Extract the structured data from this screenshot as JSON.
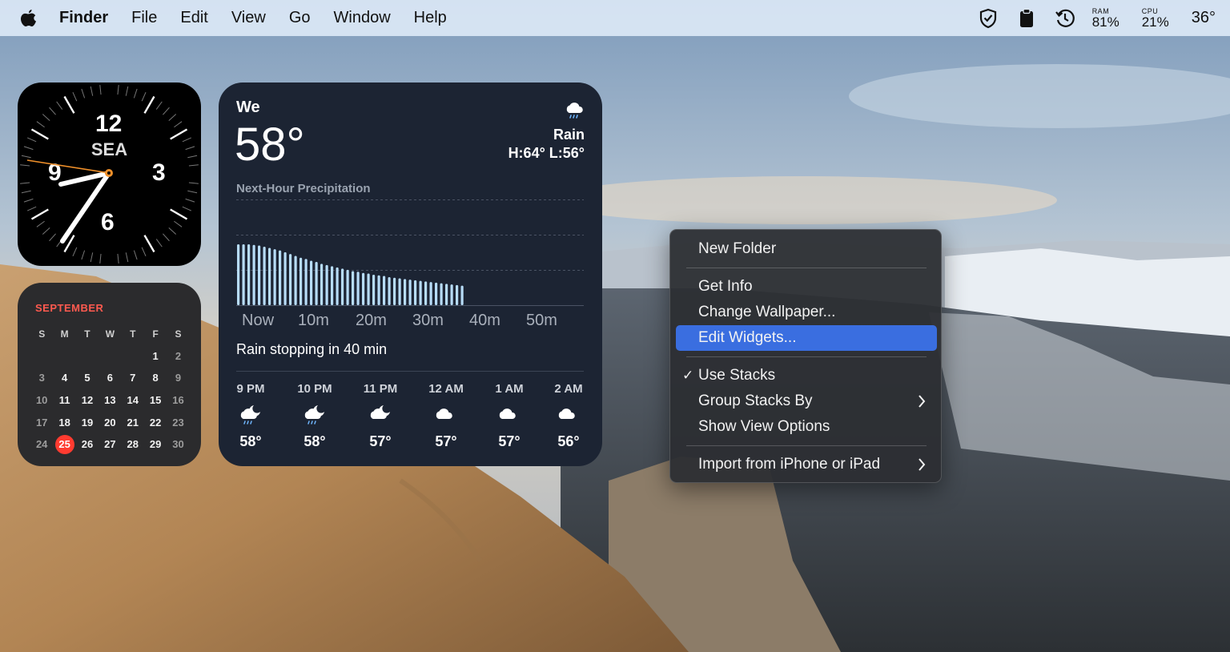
{
  "menubar": {
    "app_name": "Finder",
    "menus": [
      "File",
      "Edit",
      "View",
      "Go",
      "Window",
      "Help"
    ],
    "ram": {
      "label": "RAM",
      "value": "81%"
    },
    "cpu": {
      "label": "CPU",
      "value": "21%"
    },
    "temperature": "36°"
  },
  "clock": {
    "numbers": [
      "12",
      "3",
      "6",
      "9"
    ],
    "city": "SEA"
  },
  "calendar": {
    "month": "SEPTEMBER",
    "weekdays": [
      "S",
      "M",
      "T",
      "W",
      "T",
      "F",
      "S"
    ],
    "weeks": [
      [
        "",
        "",
        "",
        "",
        "",
        "1",
        "2"
      ],
      [
        "3",
        "4",
        "5",
        "6",
        "7",
        "8",
        "9"
      ],
      [
        "10",
        "11",
        "12",
        "13",
        "14",
        "15",
        "16"
      ],
      [
        "17",
        "18",
        "19",
        "20",
        "21",
        "22",
        "23"
      ],
      [
        "24",
        "25",
        "26",
        "27",
        "28",
        "29",
        "30"
      ]
    ],
    "today": "25"
  },
  "weather": {
    "location": "We",
    "temperature": "58°",
    "condition": "Rain",
    "hilo": "H:64° L:56°",
    "precip_title": "Next-Hour Precipitation",
    "precip_ticks": [
      "Now",
      "10m",
      "20m",
      "30m",
      "40m",
      "50m"
    ],
    "precip_intensity": [
      1.0,
      1.0,
      1.0,
      0.99,
      0.98,
      0.96,
      0.94,
      0.92,
      0.9,
      0.87,
      0.84,
      0.81,
      0.78,
      0.76,
      0.73,
      0.71,
      0.68,
      0.66,
      0.64,
      0.62,
      0.6,
      0.58,
      0.56,
      0.55,
      0.53,
      0.52,
      0.5,
      0.49,
      0.48,
      0.46,
      0.45,
      0.44,
      0.43,
      0.42,
      0.41,
      0.4,
      0.39,
      0.38,
      0.37,
      0.36,
      0.35,
      0.34,
      0.33,
      0.32
    ],
    "rain_message": "Rain stopping in 40 min",
    "hourly": [
      {
        "time": "9 PM",
        "icon": "cloud-moon-rain-icon",
        "temp": "58°"
      },
      {
        "time": "10 PM",
        "icon": "cloud-moon-rain-icon",
        "temp": "58°"
      },
      {
        "time": "11 PM",
        "icon": "cloud-moon-icon",
        "temp": "57°"
      },
      {
        "time": "12 AM",
        "icon": "cloud-icon",
        "temp": "57°"
      },
      {
        "time": "1 AM",
        "icon": "cloud-icon",
        "temp": "57°"
      },
      {
        "time": "2 AM",
        "icon": "cloud-icon",
        "temp": "56°"
      }
    ]
  },
  "context_menu": {
    "new_folder": "New Folder",
    "get_info": "Get Info",
    "change_wallpaper": "Change Wallpaper...",
    "edit_widgets": "Edit Widgets...",
    "use_stacks": "Use Stacks",
    "group_stacks_by": "Group Stacks By",
    "show_view_options": "Show View Options",
    "import_from_iphone": "Import from iPhone or iPad"
  },
  "colors": {
    "menu_highlight": "#3a6ee0",
    "today_badge": "#ff3b30",
    "calendar_month": "#ff5a4f",
    "precip_bar": "#b7dcf7"
  }
}
